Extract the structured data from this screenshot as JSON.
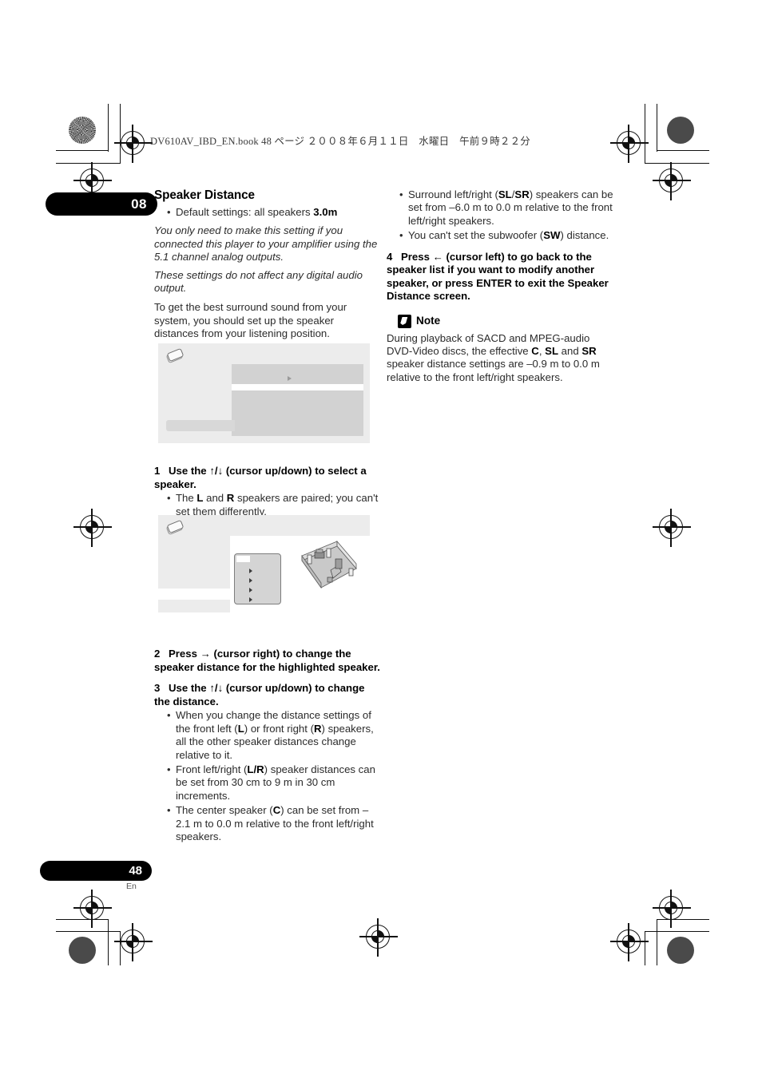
{
  "document": {
    "header_line": "DV610AV_IBD_EN.book   48 ページ   ２００８年６月１１日　水曜日　午前９時２２分",
    "chapter_number": "08",
    "page_number": "48",
    "language_code": "En"
  },
  "left_column": {
    "section_title": "Speaker Distance",
    "default_bullet_prefix": "Default settings: all speakers ",
    "default_bullet_value": "3.0m",
    "italic_note_1": "You only need to make this setting if you connected this player to your amplifier using the 5.1 channel analog outputs.",
    "italic_note_2": "These settings do not affect any digital audio output.",
    "intro_paragraph": "To get the best surround sound from your system, you should set up the speaker distances from your listening position.",
    "step1": {
      "number": "1",
      "text_a": "Use the ",
      "cursor_glyphs": "↑/↓",
      "text_b": " (cursor up/down) to select a speaker.",
      "bullets": [
        {
          "a": "The ",
          "b1": "L",
          "c": " and ",
          "b2": "R",
          "d": " speakers are paired; you can't set them differently."
        }
      ]
    },
    "step2": {
      "number": "2",
      "text_a": "Press ",
      "cursor_glyphs": "→",
      "text_b": " (cursor right) to change the speaker distance for the highlighted speaker."
    },
    "step3": {
      "number": "3",
      "text_a": "Use the ",
      "cursor_glyphs": "↑/↓",
      "text_b": " (cursor up/down) to change the distance."
    },
    "step3_bullets": [
      {
        "a": "When you change the distance settings of the front left (",
        "b1": "L",
        "c": ") or front right (",
        "b2": "R",
        "d": ") speakers, all the other speaker distances change relative to it."
      },
      {
        "a": "Front left/right (",
        "b1": "L/R",
        "c": ") speaker distances can be set from 30 cm to 9 m in 30 cm increments.",
        "b2": "",
        "d": ""
      },
      {
        "a": "The center speaker (",
        "b1": "C",
        "c": ") can be set from –2.1 m to 0.0 m relative to the front left/right speakers.",
        "b2": "",
        "d": ""
      }
    ]
  },
  "right_column": {
    "bullets": [
      {
        "a": "Surround left/right (",
        "b1": "SL",
        "sep": "/",
        "b2": "SR",
        "c": ") speakers can be set from –6.0 m to 0.0 m relative to the front left/right speakers."
      },
      {
        "a": "You can't set the subwoofer (",
        "b1": "SW",
        "sep": "",
        "b2": "",
        "c": ") distance."
      }
    ],
    "step4": {
      "number": "4",
      "text_a": "Press ",
      "cursor_glyphs": "←",
      "text_b": " (cursor left) to go back to the speaker list if you want to modify another speaker, or press ENTER to exit the Speaker Distance screen."
    },
    "note": {
      "title": "Note",
      "body_a": "During playback of SACD and MPEG-audio DVD-Video discs, the effective ",
      "b1": "C",
      "sep1": ", ",
      "b2": "SL",
      "sep2": " and ",
      "b3": "SR",
      "body_b": " speaker distance settings are –0.9 m to 0.0 m relative to the front left/right speakers."
    }
  },
  "figures": {
    "figure1": {
      "caption_icon": "disc-icon",
      "description": "On-screen display showing Speaker Distance setup menu"
    },
    "figure2": {
      "caption_icon": "disc-icon",
      "description": "On-screen display with speaker list and 3D room layout diagram"
    }
  },
  "colors": {
    "figure_background": "#ececec",
    "panel_gray": "#d2d2d2",
    "text": "#2b2b2b",
    "badge": "#000000"
  }
}
